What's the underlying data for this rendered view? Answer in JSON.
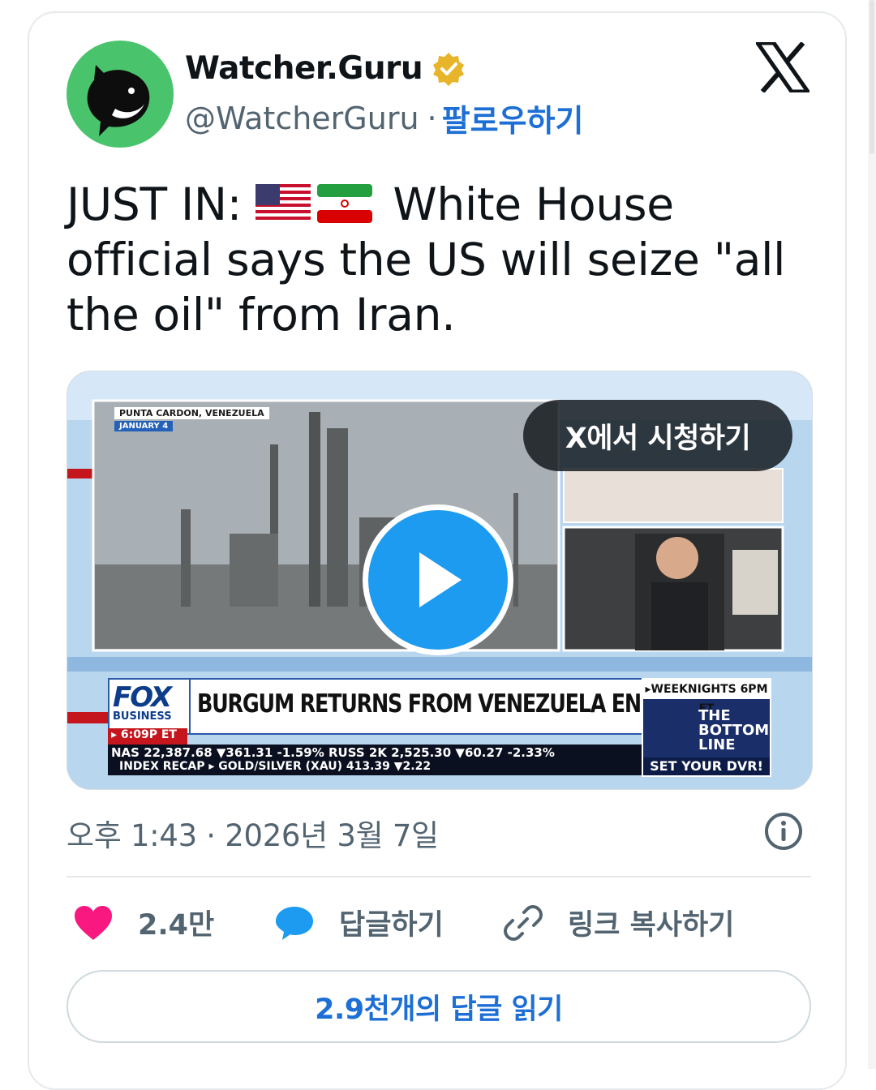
{
  "author": {
    "display_name": "Watcher.Guru",
    "handle": "@WatcherGuru",
    "separator": "·",
    "follow_label": "팔로우하기"
  },
  "tweet": {
    "prefix": "JUST IN:",
    "text": "White House official says the US will seize \"all the oil\" from Iran."
  },
  "media": {
    "watch_label": "X에서 시청하기",
    "location": "PUNTA CARDON, VENEZUELA",
    "date": "JANUARY 4",
    "network": "FOX",
    "network_sub": "BUSINESS",
    "time": "▸ 6:09P ET",
    "headline": "BURGUM RETURNS FROM VENEZUELA ENERGY TOUR",
    "ticker_line_1": "NAS  22,387.68 ▼361.31 -1.59% RUSS 2K  2,525.30 ▼60.27 -2.33%",
    "ticker_line_2": "INDEX RECAP ▸ GOLD/SILVER (XAU) 413.39 ▼2.22",
    "promo_top": "▸WEEKNIGHTS 6PM ET",
    "promo_title": "THE BOTTOM LINE",
    "promo_dvr": "SET YOUR DVR!"
  },
  "timestamp": "오후 1:43 · 2026년 3월 7일",
  "actions": {
    "like_count": "2.4만",
    "reply_label": "답글하기",
    "copy_link_label": "링크 복사하기"
  },
  "read_replies_label": "2.9천개의 답글 읽기",
  "colors": {
    "accent": "#1d6fd6",
    "heart": "#f91880",
    "reply_bubble": "#1d9bf0",
    "muted": "#536471",
    "avatar_bg": "#49c46c"
  },
  "icons": [
    "verified-badge-icon",
    "x-logo-icon",
    "us-flag-icon",
    "iran-flag-icon",
    "play-icon",
    "info-icon",
    "heart-icon",
    "reply-bubble-icon",
    "link-icon"
  ]
}
